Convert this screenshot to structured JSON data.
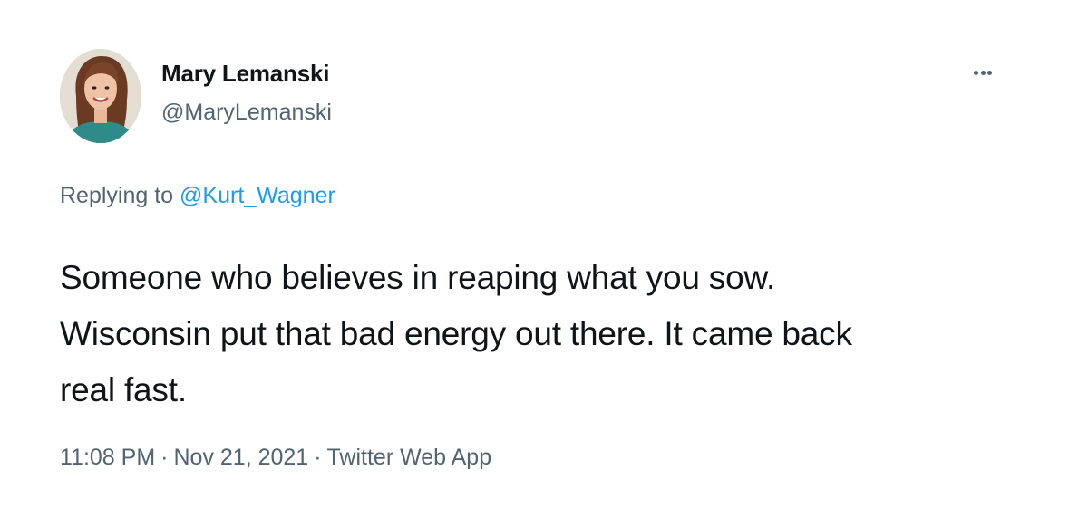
{
  "author": {
    "display_name": "Mary Lemanski",
    "handle": "@MaryLemanski"
  },
  "reply": {
    "prefix": "Replying to ",
    "target": "@Kurt_Wagner"
  },
  "tweet": {
    "lines": [
      "Someone who believes in reaping what you sow.",
      "Wisconsin put that bad energy out there. It came back",
      "real fast."
    ]
  },
  "meta": {
    "time": "11:08 PM",
    "separator": "·",
    "date": "Nov 21, 2021",
    "source": "Twitter Web App"
  },
  "icons": {
    "more": "more-options-icon",
    "avatar": "profile-avatar"
  },
  "colors": {
    "text": "#0f1419",
    "secondary": "#536471",
    "link": "#1d9bf0"
  }
}
